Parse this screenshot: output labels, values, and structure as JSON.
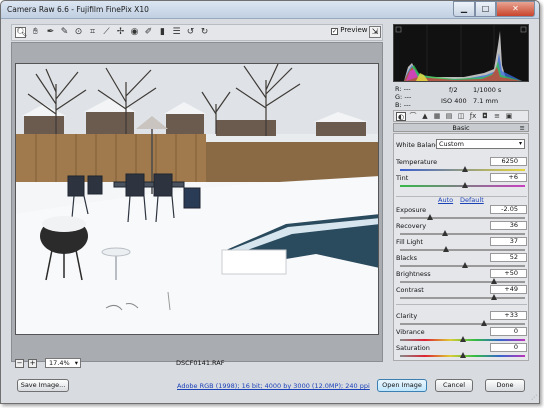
{
  "window": {
    "title": "Camera Raw 6.6  -  Fujifilm FinePix X10"
  },
  "toolbar": {
    "tools": [
      "zoom-icon",
      "hand-icon",
      "white-balance-icon",
      "color-sampler-icon",
      "target-adjust-icon",
      "crop-icon",
      "straighten-icon",
      "spot-removal-icon",
      "red-eye-icon",
      "adjustment-brush-icon",
      "graduated-filter-icon",
      "preferences-icon",
      "rotate-ccw-icon",
      "rotate-cw-icon"
    ],
    "preview_label": "Preview",
    "preview_checked": true
  },
  "readout": {
    "r_label": "R:",
    "g_label": "G:",
    "b_label": "B:",
    "r_value": "---",
    "g_value": "---",
    "b_value": "---",
    "aperture": "f/2",
    "shutter": "1/1000 s",
    "iso": "ISO 400",
    "focal": "7.1 mm"
  },
  "panel": {
    "title": "Basic",
    "white_balance_label": "White Balance:",
    "white_balance_value": "Custom",
    "auto_link": "Auto",
    "default_link": "Default",
    "sliders": [
      {
        "label": "Temperature",
        "value": "6250",
        "level": 0.52
      },
      {
        "label": "Tint",
        "value": "+6",
        "level": 0.52
      },
      {
        "label": "Exposure",
        "value": "-2.05",
        "level": 0.24
      },
      {
        "label": "Recovery",
        "value": "36",
        "level": 0.36
      },
      {
        "label": "Fill Light",
        "value": "37",
        "level": 0.37
      },
      {
        "label": "Blacks",
        "value": "52",
        "level": 0.52
      },
      {
        "label": "Brightness",
        "value": "+50",
        "level": 0.75
      },
      {
        "label": "Contrast",
        "value": "+49",
        "level": 0.75
      },
      {
        "label": "Clarity",
        "value": "+33",
        "level": 0.67
      },
      {
        "label": "Vibrance",
        "value": "0",
        "level": 0.5
      },
      {
        "label": "Saturation",
        "value": "0",
        "level": 0.5
      }
    ]
  },
  "zoom": {
    "value": "17.4%"
  },
  "file": {
    "name": "DSCF0141.RAF"
  },
  "workflow_info": "Adobe RGB (1998); 16 bit; 4000 by 3000 (12.0MP); 240 ppi",
  "buttons": {
    "save": "Save Image...",
    "open": "Open Image",
    "cancel": "Cancel",
    "done": "Done"
  }
}
